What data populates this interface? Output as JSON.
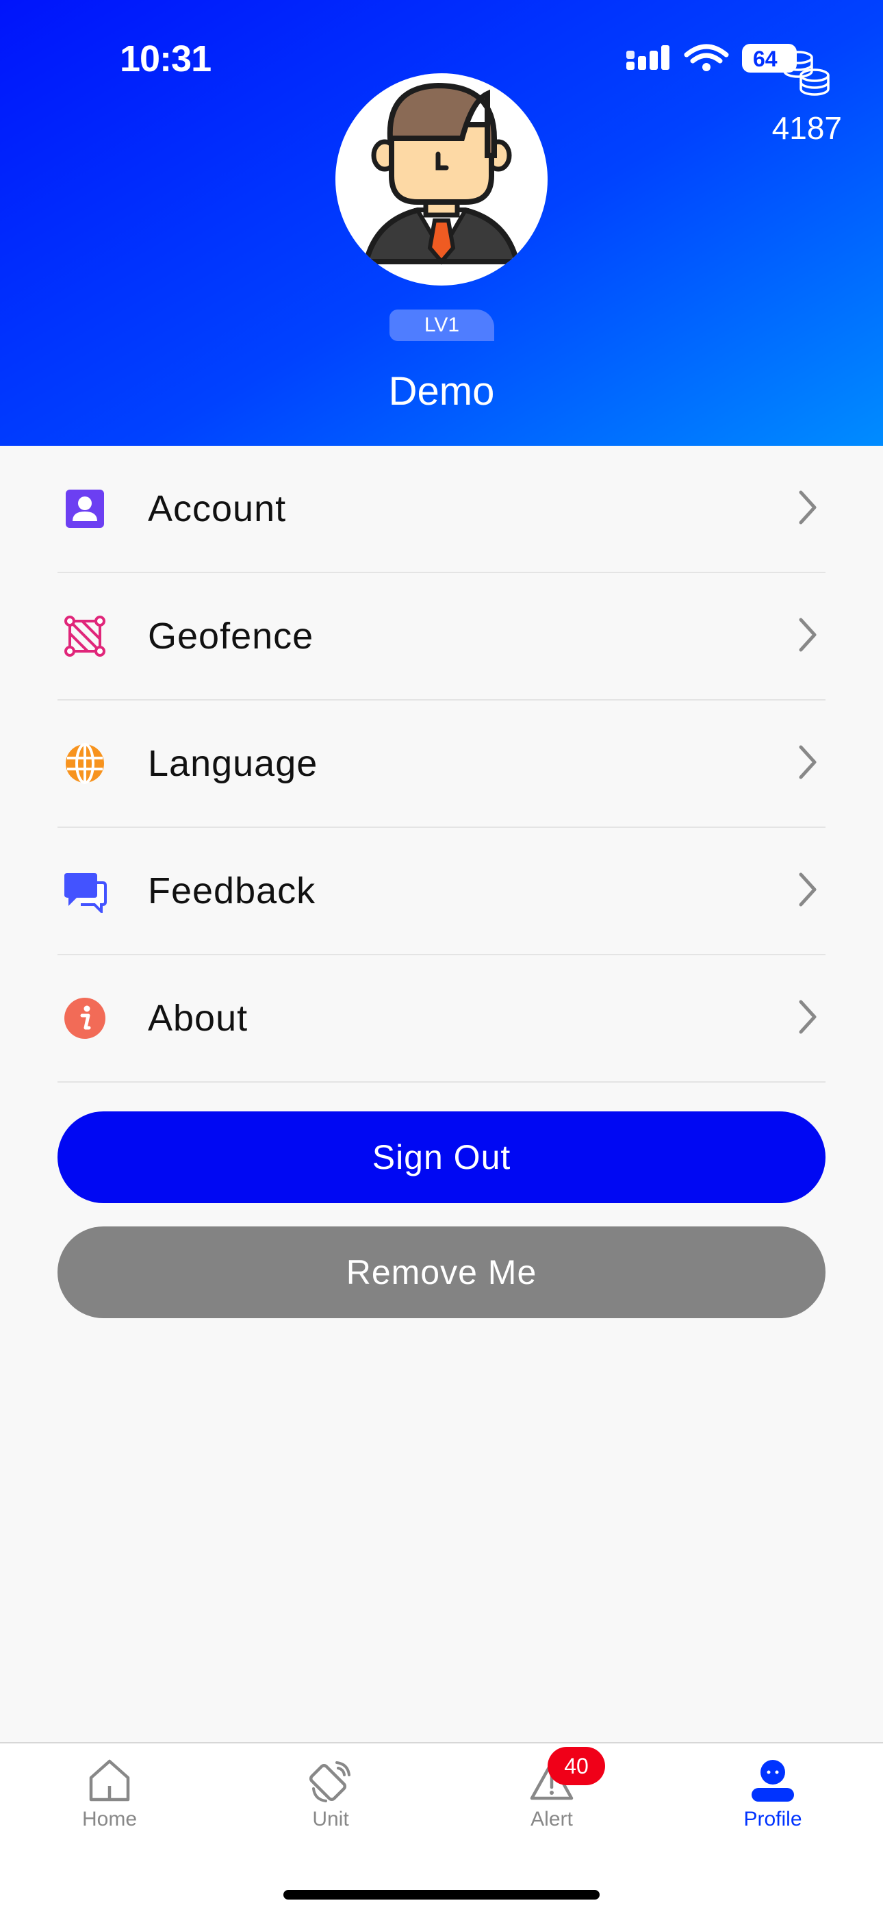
{
  "status_bar": {
    "time": "10:31",
    "battery": "64"
  },
  "header": {
    "coins": "4187",
    "level": "LV1",
    "username": "Demo"
  },
  "menu": {
    "items": [
      {
        "label": "Account",
        "icon": "account-icon",
        "color": "#6c3ff2"
      },
      {
        "label": "Geofence",
        "icon": "geofence-icon",
        "color": "#e0267a"
      },
      {
        "label": "Language",
        "icon": "globe-icon",
        "color": "#f7931e"
      },
      {
        "label": "Feedback",
        "icon": "chat-icon",
        "color": "#4353ff"
      },
      {
        "label": "About",
        "icon": "info-icon",
        "color": "#f26b57"
      }
    ]
  },
  "buttons": {
    "sign_out": "Sign Out",
    "remove_me": "Remove Me"
  },
  "tabbar": {
    "tabs": [
      {
        "label": "Home",
        "icon": "home-icon"
      },
      {
        "label": "Unit",
        "icon": "unit-icon"
      },
      {
        "label": "Alert",
        "icon": "alert-icon",
        "badge": "40"
      },
      {
        "label": "Profile",
        "icon": "profile-icon",
        "active": true
      }
    ]
  },
  "colors": {
    "primary": "#0008f3",
    "header_start": "#0014fb",
    "header_end": "#008cff",
    "muted_button": "#838383"
  }
}
